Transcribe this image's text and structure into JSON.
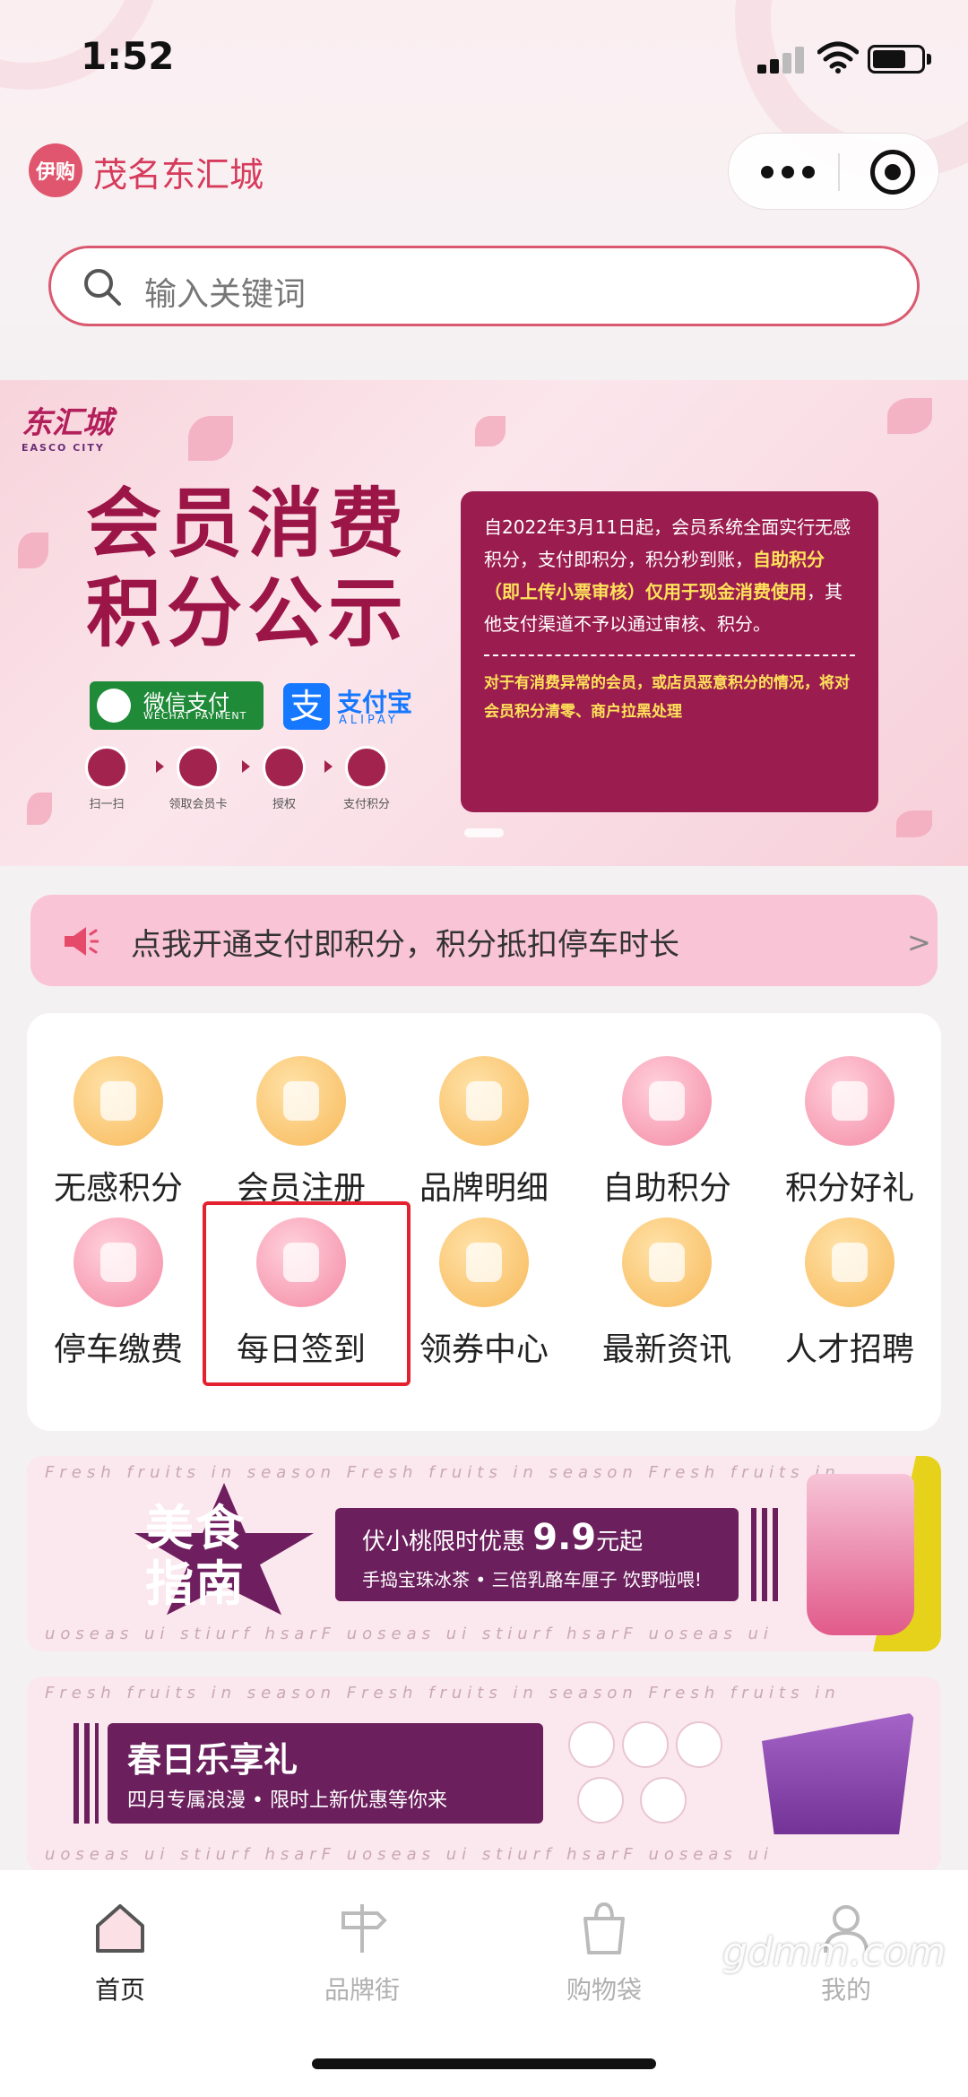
{
  "status_bar": {
    "time": "1:52"
  },
  "header": {
    "logo_text": "伊购",
    "title": "茂名东汇城"
  },
  "search": {
    "placeholder": "输入关键词"
  },
  "banner": {
    "brand_cn": "东汇城",
    "brand_en": "EASCO CITY",
    "headline_1": "会员消费",
    "headline_2": "积分公示",
    "wechat_pay": "微信支付",
    "wechat_pay_en": "WECHAT PAYMENT",
    "alipay_char": "支",
    "alipay": "支付宝",
    "alipay_en": "ALIPAY",
    "steps": [
      "扫一扫",
      "领取会员卡",
      "授权",
      "支付积分"
    ],
    "notice_1": "自2022年3月11日起，会员系统全面实行无感积分，支付即积分，积分秒到账，",
    "notice_highlight": "自助积分（即上传小票审核）仅用于现金消费使用",
    "notice_2": "，其他支付渠道不予以通过审核、积分。",
    "warning": "对于有消费异常的会员，或店员恶意积分的情况，将对会员积分清零、商户拉黑处理"
  },
  "promo": {
    "text": "点我开通支付即积分，积分抵扣停车时长",
    "arrow": ">"
  },
  "grid": [
    {
      "label": "无感积分",
      "icon": "bag-coin-icon",
      "color": "orange"
    },
    {
      "label": "会员注册",
      "icon": "member-badge-icon",
      "color": "orange"
    },
    {
      "label": "品牌明细",
      "icon": "location-pin-icon",
      "color": "orange"
    },
    {
      "label": "自助积分",
      "icon": "shopping-bag-icon",
      "color": "pink"
    },
    {
      "label": "积分好礼",
      "icon": "gift-icon",
      "color": "pink"
    },
    {
      "label": "停车缴费",
      "icon": "flower-parking-icon",
      "color": "pink"
    },
    {
      "label": "每日签到",
      "icon": "calendar-icon",
      "color": "pink"
    },
    {
      "label": "领券中心",
      "icon": "coupon-icon",
      "color": "orange"
    },
    {
      "label": "最新资讯",
      "icon": "play-news-icon",
      "color": "orange"
    },
    {
      "label": "人才招聘",
      "icon": "person-icon",
      "color": "orange"
    }
  ],
  "food_banner": {
    "scroll_text": "Fresh fruits in season   Fresh fruits in season   Fresh fruits in",
    "scroll_text_bottom": "uoseas ui stiurf hsarF   uoseas ui stiurf hsarF   uoseas ui",
    "title_1": "美食",
    "title_2": "指南",
    "line1_prefix": "伏小桃限时优惠 ",
    "line1_price": "9.9",
    "line1_suffix": "元起",
    "line2": "手捣宝珠冰茶 • 三倍乳酪车厘子 饮野啦喂!"
  },
  "spring_banner": {
    "scroll_text": "Fresh fruits in season   Fresh fruits in season   Fresh fruits in",
    "scroll_text_bottom": "uoseas ui stiurf hsarF   uoseas ui stiurf hsarF   uoseas ui",
    "title": "春日乐享礼",
    "subtitle": "四月专属浪漫 • 限时上新优惠等你来"
  },
  "tabbar": [
    {
      "label": "首页",
      "icon": "home-icon",
      "active": true
    },
    {
      "label": "品牌街",
      "icon": "signpost-icon",
      "active": false
    },
    {
      "label": "购物袋",
      "icon": "shopping-bag-icon",
      "active": false
    },
    {
      "label": "我的",
      "icon": "profile-icon",
      "active": false
    }
  ],
  "watermark": "gdmm.com",
  "colors": {
    "accent": "#d63b5c",
    "banner_purple": "#9b1d4f",
    "highlight_red": "#e3212f",
    "promo_pink": "#f9c4d5"
  }
}
